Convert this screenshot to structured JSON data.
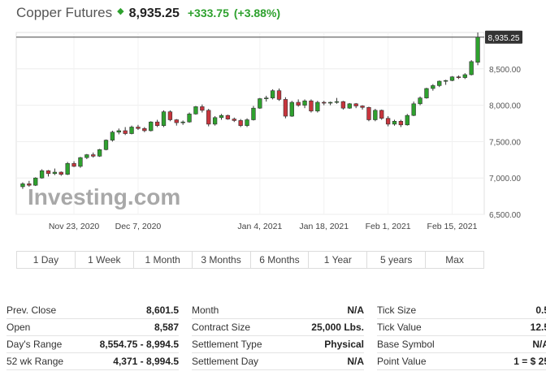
{
  "header": {
    "title": "Copper Futures",
    "price": "8,935.25",
    "change": "+333.75",
    "change_pct": "(+3.88%)",
    "up_color": "#2ea12e",
    "down_color": "#c8353d"
  },
  "watermark": "Investing.com",
  "ranges": [
    "1 Day",
    "1 Week",
    "1 Month",
    "3 Months",
    "6 Months",
    "1 Year",
    "5 years",
    "Max"
  ],
  "stats": [
    [
      [
        "Prev. Close",
        "8,601.5"
      ],
      [
        "Open",
        "8,587"
      ],
      [
        "Day's Range",
        "8,554.75 - 8,994.5"
      ],
      [
        "52 wk Range",
        "4,371 - 8,994.5"
      ]
    ],
    [
      [
        "Month",
        "N/A"
      ],
      [
        "Contract Size",
        "25,000 Lbs."
      ],
      [
        "Settlement Type",
        "Physical"
      ],
      [
        "Settlement Day",
        "N/A"
      ]
    ],
    [
      [
        "Tick Size",
        "0.5"
      ],
      [
        "Tick Value",
        "12.5"
      ],
      [
        "Base Symbol",
        "N/A"
      ],
      [
        "Point Value",
        "1 = $ 25"
      ]
    ]
  ],
  "chart_data": {
    "type": "candlestick",
    "title": "Copper Futures",
    "ylim": [
      6500,
      9000
    ],
    "yticks": [
      "6,500.00",
      "7,000.00",
      "7,500.00",
      "8,000.00",
      "8,500.00"
    ],
    "ytick_values": [
      6500,
      7000,
      7500,
      8000,
      8500
    ],
    "xtick_labels": [
      "Nov 23, 2020",
      "Dec 7, 2020",
      "Jan 4, 2021",
      "Jan 18, 2021",
      "Feb 1, 2021",
      "Feb 15, 2021"
    ],
    "xtick_index": [
      8,
      18,
      37,
      47,
      57,
      67
    ],
    "last_price": 8935.25,
    "last_price_label": "8,935.25",
    "ohlc": [
      [
        6880,
        6940,
        6850,
        6920
      ],
      [
        6920,
        6960,
        6880,
        6900
      ],
      [
        6900,
        7010,
        6890,
        7000
      ],
      [
        7000,
        7120,
        6990,
        7100
      ],
      [
        7100,
        7110,
        7020,
        7060
      ],
      [
        7060,
        7130,
        7040,
        7080
      ],
      [
        7080,
        7090,
        7030,
        7050
      ],
      [
        7050,
        7220,
        7040,
        7200
      ],
      [
        7200,
        7230,
        7150,
        7160
      ],
      [
        7160,
        7290,
        7140,
        7280
      ],
      [
        7280,
        7330,
        7260,
        7320
      ],
      [
        7320,
        7350,
        7280,
        7300
      ],
      [
        7300,
        7400,
        7290,
        7390
      ],
      [
        7390,
        7530,
        7380,
        7520
      ],
      [
        7520,
        7650,
        7500,
        7630
      ],
      [
        7630,
        7680,
        7600,
        7650
      ],
      [
        7650,
        7700,
        7590,
        7610
      ],
      [
        7610,
        7720,
        7600,
        7700
      ],
      [
        7700,
        7730,
        7660,
        7680
      ],
      [
        7680,
        7700,
        7630,
        7650
      ],
      [
        7650,
        7780,
        7640,
        7770
      ],
      [
        7770,
        7800,
        7700,
        7720
      ],
      [
        7720,
        7930,
        7700,
        7910
      ],
      [
        7910,
        7930,
        7780,
        7800
      ],
      [
        7800,
        7810,
        7720,
        7760
      ],
      [
        7760,
        7790,
        7730,
        7770
      ],
      [
        7770,
        7900,
        7760,
        7880
      ],
      [
        7880,
        7990,
        7870,
        7980
      ],
      [
        7980,
        8010,
        7900,
        7930
      ],
      [
        7930,
        7950,
        7710,
        7740
      ],
      [
        7740,
        7850,
        7720,
        7830
      ],
      [
        7830,
        7880,
        7800,
        7860
      ],
      [
        7860,
        7870,
        7800,
        7810
      ],
      [
        7810,
        7830,
        7770,
        7790
      ],
      [
        7790,
        7810,
        7700,
        7720
      ],
      [
        7720,
        7820,
        7700,
        7800
      ],
      [
        7800,
        7990,
        7790,
        7960
      ],
      [
        7960,
        8100,
        7950,
        8090
      ],
      [
        8090,
        8130,
        8050,
        8100
      ],
      [
        8100,
        8220,
        8080,
        8200
      ],
      [
        8200,
        8230,
        8060,
        8080
      ],
      [
        8080,
        8110,
        7820,
        7850
      ],
      [
        7850,
        8060,
        7840,
        8040
      ],
      [
        8040,
        8080,
        7980,
        8000
      ],
      [
        8000,
        8080,
        7960,
        8060
      ],
      [
        8060,
        8080,
        7900,
        7920
      ],
      [
        7920,
        8060,
        7900,
        8040
      ],
      [
        8040,
        8060,
        8000,
        8030
      ],
      [
        8030,
        8050,
        8000,
        8040
      ],
      [
        8040,
        8100,
        8020,
        8050
      ],
      [
        8050,
        8060,
        7940,
        7960
      ],
      [
        7960,
        8030,
        7950,
        8020
      ],
      [
        8020,
        8030,
        7960,
        7990
      ],
      [
        7990,
        8000,
        7940,
        7970
      ],
      [
        7970,
        7980,
        7780,
        7800
      ],
      [
        7800,
        7950,
        7780,
        7930
      ],
      [
        7930,
        7940,
        7800,
        7820
      ],
      [
        7820,
        7850,
        7710,
        7740
      ],
      [
        7740,
        7800,
        7720,
        7780
      ],
      [
        7780,
        7800,
        7700,
        7730
      ],
      [
        7730,
        7880,
        7720,
        7860
      ],
      [
        7860,
        8050,
        7850,
        8020
      ],
      [
        8020,
        8120,
        8000,
        8100
      ],
      [
        8100,
        8240,
        8090,
        8230
      ],
      [
        8230,
        8290,
        8200,
        8270
      ],
      [
        8270,
        8340,
        8250,
        8330
      ],
      [
        8330,
        8350,
        8280,
        8340
      ],
      [
        8340,
        8400,
        8330,
        8390
      ],
      [
        8390,
        8410,
        8360,
        8380
      ],
      [
        8380,
        8440,
        8360,
        8420
      ],
      [
        8420,
        8620,
        8410,
        8600
      ],
      [
        8590,
        9000,
        8550,
        8935
      ]
    ]
  }
}
